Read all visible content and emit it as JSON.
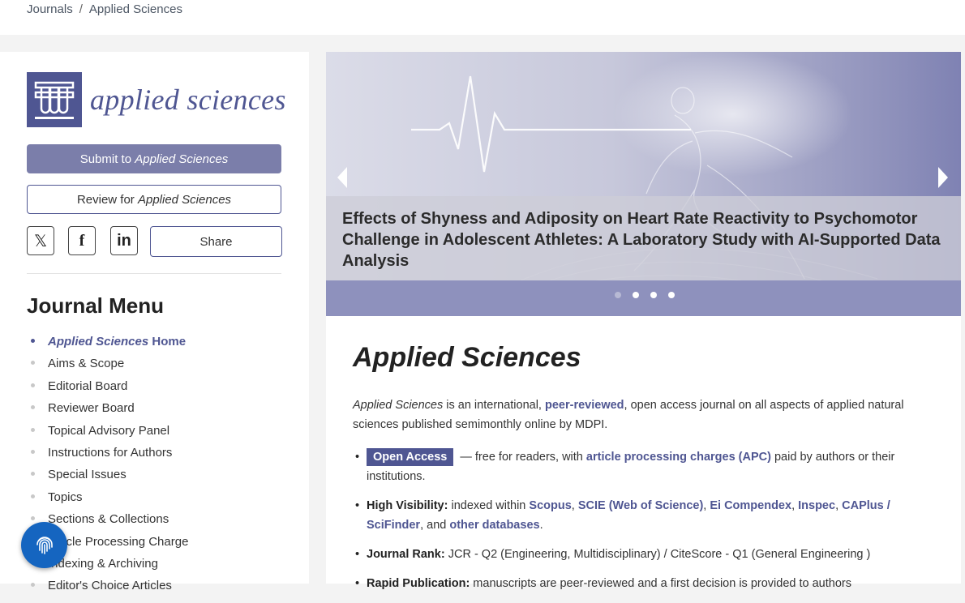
{
  "breadcrumb": {
    "journals": "Journals",
    "separator": "/",
    "current": "Applied Sciences"
  },
  "sidebar": {
    "logo_text": "applied sciences",
    "submit_prefix": "Submit to ",
    "submit_journal": "Applied Sciences",
    "review_prefix": "Review for ",
    "review_journal": "Applied Sciences",
    "social": {
      "x": "𝕏",
      "facebook": "f",
      "linkedin": "in"
    },
    "share_label": "Share",
    "menu_title": "Journal Menu",
    "menu_home_italic": "Applied Sciences",
    "menu_home_suffix": " Home",
    "menu_items": [
      "Aims & Scope",
      "Editorial Board",
      "Reviewer Board",
      "Topical Advisory Panel",
      "Instructions for Authors",
      "Special Issues",
      "Topics",
      "Sections & Collections",
      "Article Processing Charge",
      "Indexing & Archiving",
      "Editor's Choice Articles"
    ]
  },
  "banner": {
    "title": "Effects of Shyness and Adiposity on Heart Rate Reactivity to Psychomotor Challenge in Adolescent Athletes: A Laboratory Study with AI-Supported Data Analysis",
    "slide_count": 4,
    "active_slide": 2
  },
  "main": {
    "title": "Applied Sciences",
    "intro_italic": "Applied Sciences",
    "intro_1": " is an international, ",
    "intro_link": "peer-reviewed",
    "intro_2": ", open access journal on all aspects of applied natural sciences published semimonthly online by MDPI.",
    "oa_badge": "Open Access",
    "oa_text_1": " — free for readers, with ",
    "oa_link": "article processing charges (APC)",
    "oa_text_2": " paid by authors or their institutions.",
    "hv_label": "High Visibility:",
    "hv_text_1": " indexed within ",
    "hv_scopus": "Scopus",
    "hv_comma1": ", ",
    "hv_scie": "SCIE (Web of Science)",
    "hv_comma2": ", ",
    "hv_ei": "Ei Compendex",
    "hv_comma3": ", ",
    "hv_inspec": "Inspec",
    "hv_comma4": ", ",
    "hv_caplus": "CAPlus / SciFinder",
    "hv_and": ", and ",
    "hv_other": "other databases",
    "hv_end": ".",
    "jr_label": "Journal Rank:",
    "jr_text": " JCR - Q2 (Engineering, Multidisciplinary) / CiteScore - Q1 (General Engineering )",
    "rp_label": "Rapid Publication:",
    "rp_text": " manuscripts are peer-reviewed and a first decision is provided to authors"
  },
  "colors": {
    "brand": "#4f5692",
    "fab": "#1565c0"
  },
  "icons": {
    "fab": "fingerprint-icon",
    "prev": "arrow-left-icon",
    "next": "arrow-right-icon"
  }
}
